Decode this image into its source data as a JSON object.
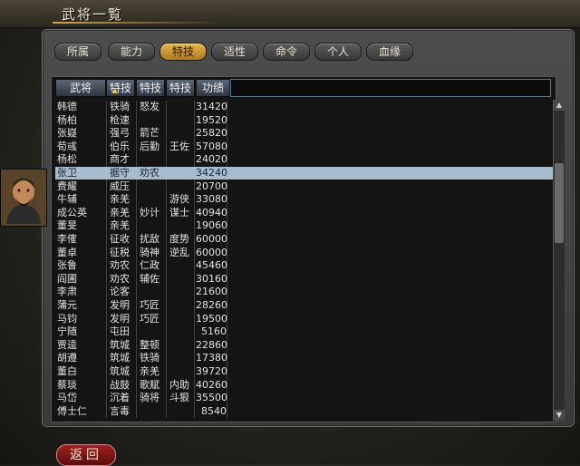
{
  "window": {
    "title": "武将一覧"
  },
  "tabs": [
    {
      "label": "所属",
      "active": false
    },
    {
      "label": "能力",
      "active": false
    },
    {
      "label": "特技",
      "active": true
    },
    {
      "label": "适性",
      "active": false
    },
    {
      "label": "命令",
      "active": false
    },
    {
      "label": "个人",
      "active": false
    },
    {
      "label": "血缘",
      "active": false
    }
  ],
  "table": {
    "headers": [
      "武将",
      "特技",
      "特技",
      "特技",
      "功绩"
    ],
    "sorted_column": "特技",
    "rows": [
      {
        "name": "韩德",
        "s1": "铁骑",
        "s2": "怒发",
        "s3": "",
        "merit": "31420"
      },
      {
        "name": "杨柏",
        "s1": "枪速",
        "s2": "",
        "s3": "",
        "merit": "19520"
      },
      {
        "name": "张嶷",
        "s1": "强弓",
        "s2": "箭芒",
        "s3": "",
        "merit": "25820"
      },
      {
        "name": "荀彧",
        "s1": "伯乐",
        "s2": "后勤",
        "s3": "王佐",
        "merit": "57080"
      },
      {
        "name": "杨松",
        "s1": "商才",
        "s2": "",
        "s3": "",
        "merit": "24020"
      },
      {
        "name": "张卫",
        "s1": "据守",
        "s2": "劝农",
        "s3": "",
        "merit": "34240",
        "selected": true
      },
      {
        "name": "费耀",
        "s1": "威压",
        "s2": "",
        "s3": "",
        "merit": "20700"
      },
      {
        "name": "牛辅",
        "s1": "亲羌",
        "s2": "",
        "s3": "游侠",
        "merit": "33080"
      },
      {
        "name": "成公英",
        "s1": "亲羌",
        "s2": "妙计",
        "s3": "谋士",
        "merit": "40940"
      },
      {
        "name": "董旻",
        "s1": "亲羌",
        "s2": "",
        "s3": "",
        "merit": "19060"
      },
      {
        "name": "李傕",
        "s1": "征收",
        "s2": "扰敌",
        "s3": "度势",
        "merit": "60000"
      },
      {
        "name": "董卓",
        "s1": "征税",
        "s2": "骑神",
        "s3": "逆乱",
        "merit": "60000"
      },
      {
        "name": "张鲁",
        "s1": "劝农",
        "s2": "仁政",
        "s3": "",
        "merit": "45460"
      },
      {
        "name": "阎圃",
        "s1": "劝农",
        "s2": "辅佐",
        "s3": "",
        "merit": "30160"
      },
      {
        "name": "李肃",
        "s1": "论客",
        "s2": "",
        "s3": "",
        "merit": "21600"
      },
      {
        "name": "蒲元",
        "s1": "发明",
        "s2": "巧匠",
        "s3": "",
        "merit": "28260"
      },
      {
        "name": "马钧",
        "s1": "发明",
        "s2": "巧匠",
        "s3": "",
        "merit": "19500"
      },
      {
        "name": "宁随",
        "s1": "屯田",
        "s2": "",
        "s3": "",
        "merit": "5160"
      },
      {
        "name": "贾逵",
        "s1": "筑城",
        "s2": "整顿",
        "s3": "",
        "merit": "22860"
      },
      {
        "name": "胡遵",
        "s1": "筑城",
        "s2": "铁骑",
        "s3": "",
        "merit": "17380"
      },
      {
        "name": "董白",
        "s1": "筑城",
        "s2": "亲羌",
        "s3": "",
        "merit": "39720"
      },
      {
        "name": "蔡琰",
        "s1": "战鼓",
        "s2": "歌赋",
        "s3": "内助",
        "merit": "40260"
      },
      {
        "name": "马岱",
        "s1": "沉着",
        "s2": "骑将",
        "s3": "斗狠",
        "merit": "35500"
      },
      {
        "name": "傅士仁",
        "s1": "言毒",
        "s2": "",
        "s3": "",
        "merit": "8540"
      }
    ]
  },
  "buttons": {
    "back": "返回"
  },
  "colors": {
    "selected_row": "#a9bccd",
    "active_tab": "#d9a23a",
    "back_button": "#8a1a1a"
  }
}
